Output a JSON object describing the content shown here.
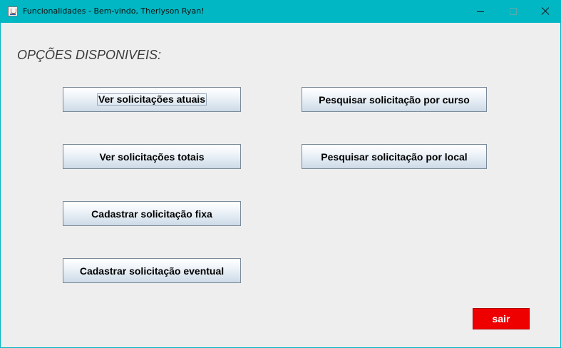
{
  "window": {
    "title": "Funcionalidades - Bem-vindo, Therlyson Ryan!",
    "app_icon": "java-icon",
    "controls": {
      "minimize": "minimize-icon",
      "maximize": "maximize-icon",
      "close": "close-icon"
    },
    "title_bar_color": "#00b7c3"
  },
  "main": {
    "heading": "OPÇÕES DISPONIVEIS:",
    "left_buttons": [
      "Ver solicitações atuais",
      "Ver solicitações totais",
      "Cadastrar solicitação fixa",
      "Cadastrar solicitação eventual"
    ],
    "right_buttons": [
      "Pesquisar solicitação por curso",
      "Pesquisar solicitação por local"
    ],
    "exit_button": {
      "label": "sair",
      "color": "#ee0000"
    }
  }
}
